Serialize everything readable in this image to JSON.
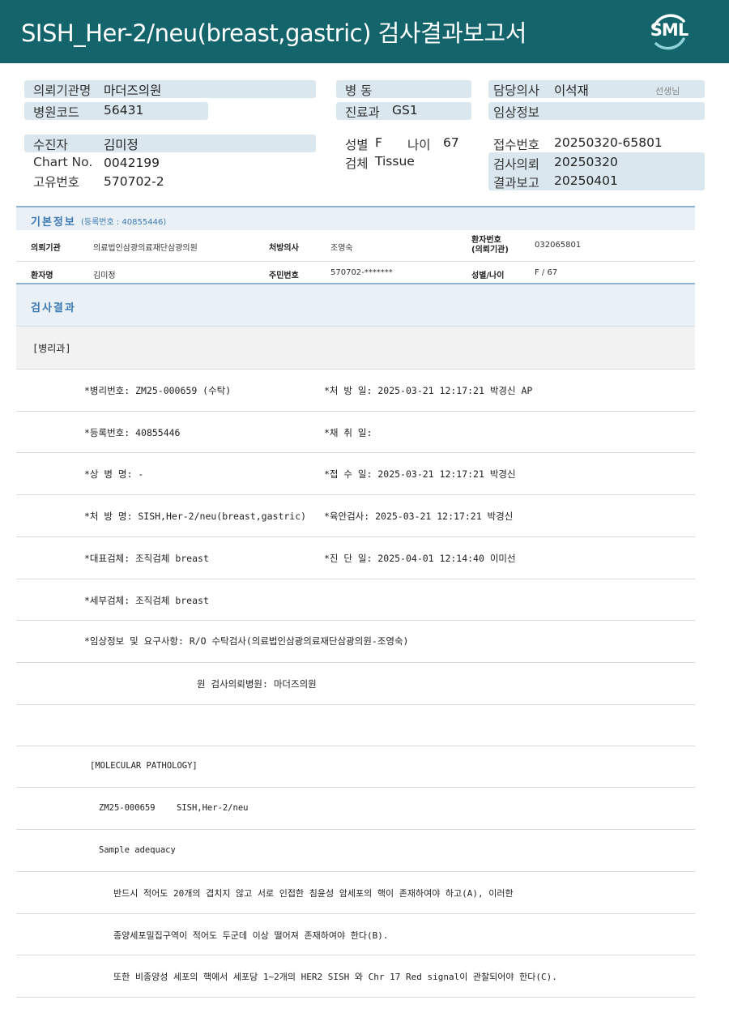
{
  "header": {
    "title": "SISH_Her-2/neu(breast,gastric) 검사결과보고서",
    "logo": "SML"
  },
  "info": {
    "org_label": "의뢰기관명",
    "org_value": "마더즈의원",
    "code_label": "병원코드",
    "code_value": "56431",
    "ward_label": "병  동",
    "dept_label": "진료과",
    "dept_value": "GS1",
    "doctor_label": "담당의사",
    "doctor_value": "이석재",
    "doctor_suffix": "선생님",
    "clinical_label": "임상정보",
    "patient_label": "수진자",
    "patient_value": "김미정",
    "chart_label": "Chart No.",
    "chart_value": "0042199",
    "uid_label": "고유번호",
    "uid_value": "570702-2",
    "sex_label": "성별",
    "sex_value": "F",
    "age_label": "나이",
    "age_value": "67",
    "specimen_label": "검체",
    "specimen_value": "Tissue",
    "receipt_label": "접수번호",
    "receipt_value": "20250320-65801",
    "request_label": "검사의뢰",
    "request_value": "20250320",
    "report_label": "결과보고",
    "report_value": "20250401"
  },
  "basic": {
    "title": "기본정보",
    "reg": "(등록번호 : 40855446)",
    "rows": [
      {
        "k1": "의뢰기관",
        "v1": "의료법인삼광의료재단삼광의원",
        "k2": "처방의사",
        "v2": "조영숙",
        "k3a": "환자번호",
        "k3b": "(의뢰기관)",
        "v3": "032065801"
      },
      {
        "k1": "환자명",
        "v1": "김미정",
        "k2": "주민번호",
        "v2": "570702-*******",
        "k3a": "성별/나이",
        "k3b": "",
        "v3": "F / 67"
      }
    ]
  },
  "result": {
    "title": "검사결과",
    "dept": "[병리과]",
    "lines": [
      {
        "left": "*병리번호: ZM25-000659 (수탁)",
        "right": "*처 방 일: 2025-03-21 12:17:21  박경신 AP"
      },
      {
        "left": "*등록번호: 40855446",
        "right": "*채 취 일:"
      },
      {
        "left": "*상 병 명: -",
        "right": "*접 수 일: 2025-03-21 12:17:21  박경신"
      },
      {
        "left": "*처 방 명: SISH,Her-2/neu(breast,gastric)",
        "right": "*육안검사: 2025-03-21 12:17:21  박경신"
      },
      {
        "left": "*대표검체: 조직검체 breast",
        "right": "*진 단 일: 2025-04-01 12:14:40  이미선"
      },
      {
        "left": "*세부검체: 조직검체 breast",
        "right": ""
      },
      {
        "left": "*임상정보 및 요구사항: R/O 수탁검사(의료법인삼광의료재단삼광의원-조영숙)",
        "right": ""
      }
    ],
    "origin": "원 검사의뢰병원: 마더즈의원",
    "molecular": "[MOLECULAR PATHOLOGY]",
    "case_no": "ZM25-000659",
    "case_test": "SISH,Her-2/neu",
    "adequacy": "Sample adequacy",
    "para1": "반드시 적어도 20개의 겹치지 않고 서로 인접한 침윤성 암세포의 핵이 존재하여야 하고(A), 이러한",
    "para2": "종양세포밀집구역이 적어도 두군데 이상 떨어져 존재하여야 한다(B).",
    "para3": "또한 비종양성 세포의 핵에서 세포당 1~2개의 HER2 SISH 와 Chr 17 Red signal이 관찰되어야 한다(C)."
  }
}
